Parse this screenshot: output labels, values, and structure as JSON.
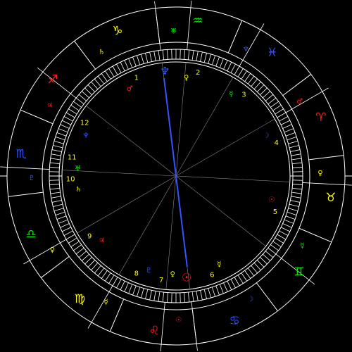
{
  "chart": {
    "house_numbers": [
      "1",
      "2",
      "3",
      "4",
      "5",
      "6",
      "7",
      "8",
      "9",
      "10",
      "11",
      "12"
    ],
    "signs": [
      {
        "glyph": "♑",
        "color": "#ffff00",
        "ruler": "♄",
        "ruler_color": "#ffff00"
      },
      {
        "glyph": "♐",
        "color": "#ff2020",
        "ruler": "♃",
        "ruler_color": "#ff2020"
      },
      {
        "glyph": "♏",
        "color": "#3355ff",
        "ruler": "♇",
        "ruler_color": "#3355ff"
      },
      {
        "glyph": "♎",
        "color": "#00ee00",
        "ruler": "♀",
        "ruler_color": "#ffff00"
      },
      {
        "glyph": "♍",
        "color": "#ffff00",
        "ruler": "☿",
        "ruler_color": "#ffff00"
      },
      {
        "glyph": "♌",
        "color": "#ff2020",
        "ruler": "☉",
        "ruler_color": "#ff2020"
      },
      {
        "glyph": "♋",
        "color": "#3355ff",
        "ruler": "☽",
        "ruler_color": "#3355ff"
      },
      {
        "glyph": "♊",
        "color": "#00ee00",
        "ruler": "☿",
        "ruler_color": "#00ee00"
      },
      {
        "glyph": "♉",
        "color": "#ffff00",
        "ruler": "♀",
        "ruler_color": "#ffff00"
      },
      {
        "glyph": "♈",
        "color": "#ff2020",
        "ruler": "♂",
        "ruler_color": "#ff2020"
      },
      {
        "glyph": "♓",
        "color": "#3355ff",
        "ruler": "♆",
        "ruler_color": "#3355ff"
      },
      {
        "glyph": "♒",
        "color": "#00ee00",
        "ruler": "♅",
        "ruler_color": "#00ee00"
      }
    ],
    "house_rulers": [
      {
        "house": "10",
        "glyph": "♄",
        "color": "#ffff00"
      },
      {
        "house": "9",
        "glyph": "♃",
        "color": "#ff2020"
      },
      {
        "house": "8",
        "glyph": "♇",
        "color": "#3355ff"
      },
      {
        "house": "7",
        "glyph": "♀",
        "color": "#ffff00"
      },
      {
        "house": "6",
        "glyph": "☿",
        "color": "#ffff00"
      },
      {
        "house": "5",
        "glyph": "☉",
        "color": "#ff2020"
      },
      {
        "house": "4",
        "glyph": "☽",
        "color": "#3355ff"
      },
      {
        "house": "3",
        "glyph": "☿",
        "color": "#00ee00"
      },
      {
        "house": "2",
        "glyph": "♀",
        "color": "#ffff00"
      },
      {
        "house": "1",
        "glyph": "♂",
        "color": "#ff2020"
      },
      {
        "house": "12",
        "glyph": "♆",
        "color": "#3355ff"
      },
      {
        "house": "11",
        "glyph": "♅",
        "color": "#00ee00"
      }
    ],
    "planets": [
      {
        "glyph": "♆",
        "color": "#3355ff"
      },
      {
        "glyph": "☉",
        "color": "#ff2020"
      }
    ],
    "colors": {
      "background": "#000000",
      "lines": "#ffffff",
      "axis": "#3355ff",
      "house_numbers": "#ffff00"
    }
  }
}
